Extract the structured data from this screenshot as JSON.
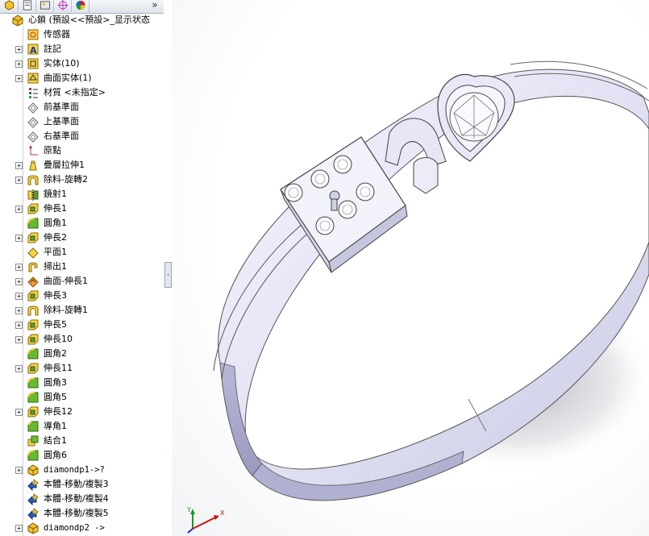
{
  "tabs": [
    {
      "name": "feature-manager-tab",
      "icon": "feature-tree-icon"
    },
    {
      "name": "property-manager-tab",
      "icon": "property-icon"
    },
    {
      "name": "configuration-manager-tab",
      "icon": "configuration-icon"
    },
    {
      "name": "dimxpert-tab",
      "icon": "crosshair-icon"
    },
    {
      "name": "display-manager-tab",
      "icon": "color-wheel-icon"
    }
  ],
  "more_label": "»",
  "root": {
    "label": "心鎖  (預設<<預設>_显示状态"
  },
  "tree": [
    {
      "label": "传感器",
      "icon": "sensor",
      "expand": false
    },
    {
      "label": "註記",
      "icon": "annotation",
      "expand": true
    },
    {
      "label": "实体(10)",
      "icon": "solid-bodies",
      "expand": true
    },
    {
      "label": "曲面实体(1)",
      "icon": "surface-bodies",
      "expand": true
    },
    {
      "label": "材質 <未指定>",
      "icon": "material",
      "expand": false
    },
    {
      "label": "前基準面",
      "icon": "plane",
      "expand": false
    },
    {
      "label": "上基準面",
      "icon": "plane",
      "expand": false
    },
    {
      "label": "右基準面",
      "icon": "plane",
      "expand": false
    },
    {
      "label": "原點",
      "icon": "origin",
      "expand": false
    },
    {
      "label": "疊層拉伸1",
      "icon": "loft",
      "expand": true
    },
    {
      "label": "除料-旋轉2",
      "icon": "revolve-cut",
      "expand": true
    },
    {
      "label": "鏡射1",
      "icon": "mirror",
      "expand": false
    },
    {
      "label": "伸長1",
      "icon": "extrude",
      "expand": true
    },
    {
      "label": "圓角1",
      "icon": "fillet",
      "expand": false
    },
    {
      "label": "伸長2",
      "icon": "extrude",
      "expand": true
    },
    {
      "label": "平面1",
      "icon": "plane-feature",
      "expand": false
    },
    {
      "label": "掃出1",
      "icon": "sweep",
      "expand": true
    },
    {
      "label": "曲面-伸長1",
      "icon": "surface-extrude",
      "expand": true
    },
    {
      "label": "伸長3",
      "icon": "extrude",
      "expand": true
    },
    {
      "label": "除料-旋轉1",
      "icon": "revolve-cut",
      "expand": true
    },
    {
      "label": "伸長5",
      "icon": "extrude",
      "expand": true
    },
    {
      "label": "伸長10",
      "icon": "extrude",
      "expand": true
    },
    {
      "label": "圓角2",
      "icon": "fillet",
      "expand": false
    },
    {
      "label": "伸長11",
      "icon": "extrude",
      "expand": true
    },
    {
      "label": "圓角3",
      "icon": "fillet",
      "expand": false
    },
    {
      "label": "圓角5",
      "icon": "fillet",
      "expand": false
    },
    {
      "label": "伸長12",
      "icon": "extrude",
      "expand": true
    },
    {
      "label": "導角1",
      "icon": "chamfer",
      "expand": false
    },
    {
      "label": "結合1",
      "icon": "combine",
      "expand": false
    },
    {
      "label": "圓角6",
      "icon": "fillet",
      "expand": false
    },
    {
      "label": "diamondp1->?",
      "icon": "part",
      "expand": true,
      "mono": true
    },
    {
      "label": "本體-移動/複製3",
      "icon": "move-copy",
      "expand": false
    },
    {
      "label": "本體-移動/複製4",
      "icon": "move-copy",
      "expand": false
    },
    {
      "label": "本體-移動/複製5",
      "icon": "move-copy",
      "expand": false
    },
    {
      "label": "diamondp2 ->",
      "icon": "part",
      "expand": true,
      "mono": true
    }
  ],
  "triad": {
    "x_label": "X",
    "y_label": "Y"
  }
}
